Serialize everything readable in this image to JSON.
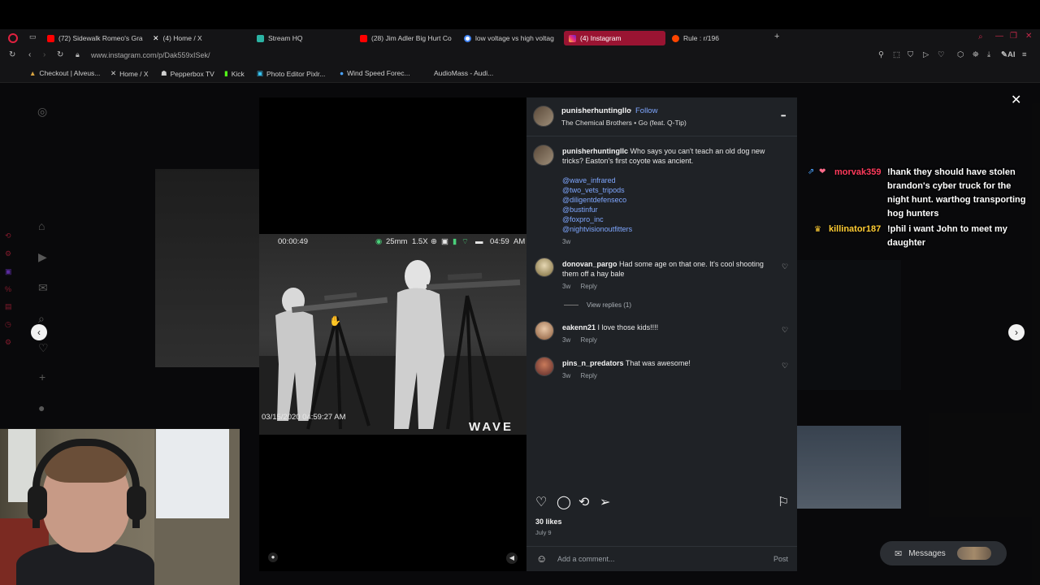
{
  "browser": {
    "tabs": [
      {
        "label": "(72) Sidewalk Romeo's Gra",
        "icon": "youtube-icon",
        "color": "#ff0000"
      },
      {
        "label": "(4) Home / X",
        "icon": "x-icon",
        "color": "#ffffff"
      },
      {
        "label": "Stream HQ",
        "icon": "stream-icon",
        "color": "#2bb3a3"
      },
      {
        "label": "(28) Jim Adler Big Hurt Co",
        "icon": "youtube-icon",
        "color": "#ff0000"
      },
      {
        "label": "low voltage vs high voltag",
        "icon": "google-icon",
        "color": "#4285f4"
      },
      {
        "label": "(4) Instagram",
        "icon": "instagram-icon",
        "color": "#e1306c"
      },
      {
        "label": "Rule : r/196",
        "icon": "reddit-icon",
        "color": "#ff4500"
      }
    ],
    "new_tab": "+",
    "url": "www.instagram.com/p/Dak559xISek/",
    "bookmarks": [
      {
        "label": "Checkout | Alveus...",
        "icon": "bookmark-icon"
      },
      {
        "label": "Home / X",
        "icon": "x-icon"
      },
      {
        "label": "Pepperbox TV",
        "icon": "bookmark-icon"
      },
      {
        "label": "Kick",
        "icon": "kick-icon"
      },
      {
        "label": "Photo Editor Pixlr...",
        "icon": "pixlr-icon"
      },
      {
        "label": "Wind Speed Forec...",
        "icon": "globe-icon"
      },
      {
        "label": "AudioMass - Audi...",
        "icon": "bookmark-icon"
      }
    ]
  },
  "post": {
    "author": "punisherhuntingllc",
    "follow": "Follow",
    "audio": "The Chemical Brothers • Go (feat. Q-Tip)",
    "caption": "Who says you can't teach an old dog new tricks? Easton's first coyote was ancient.",
    "mentions": [
      "@wave_infrared",
      "@two_vets_tripods",
      "@diligentdefenseco",
      "@bustinfur",
      "@foxpro_inc",
      "@nightvisionoutfitters"
    ],
    "caption_age": "3w",
    "comments": [
      {
        "user": "donovan_pargo",
        "text": "Had some age on that one. It's cool shooting them off a hay bale",
        "age": "3w",
        "reply": "Reply",
        "view_replies": "View replies (1)"
      },
      {
        "user": "eakenn21",
        "text": "I love those kids!!!!",
        "age": "3w",
        "reply": "Reply"
      },
      {
        "user": "pins_n_predators",
        "text": "That was awesome!",
        "age": "3w",
        "reply": "Reply"
      }
    ],
    "likes": "30 likes",
    "date": "July 9",
    "comment_placeholder": "Add a comment...",
    "post_button": "Post",
    "more": "•••"
  },
  "video_hud": {
    "timer": "00:00:49",
    "lens": "25mm",
    "zoom": "1.5X",
    "clock": "04:59",
    "ampm": "AM",
    "timestamp": "03/15/2020 04:59:27 AM",
    "brand": "WAVE"
  },
  "chat": [
    {
      "user": "morvak359",
      "user_color": "#ff3b5c",
      "text": "!hank they should have stolen brandon's cyber truck for the night hunt. warthog transporting hog hunters"
    },
    {
      "user": "killinator187",
      "user_color": "#ffcc33",
      "text": "!phil i want John to meet my daughter"
    }
  ],
  "messages": "Messages"
}
